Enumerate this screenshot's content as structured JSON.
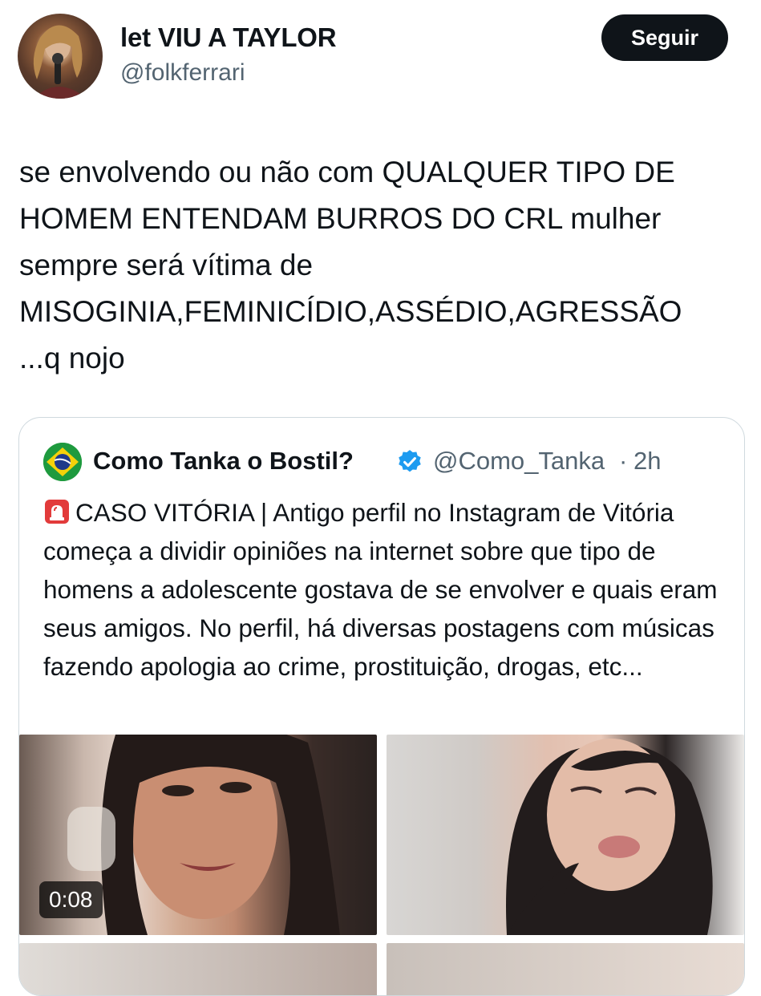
{
  "tweet": {
    "display_name": "let VIU A TAYLOR",
    "handle": "@folkferrari",
    "follow_label": "Seguir",
    "text": "se envolvendo ou não com QUALQUER TIPO DE\nHOMEM ENTENDAM BURROS DO CRL mulher\nsempre será vítima de\nMISOGINIA,FEMINICÍDIO,ASSÉDIO,AGRESSÃO\n...q nojo"
  },
  "quote": {
    "display_name": "Como Tanka o Bostil?",
    "handle": "@Como_Tanka",
    "separator": "·",
    "time": "2h",
    "text": "CASO VITÓRIA | Antigo perfil no Instagram de Vitória começa a dividir opiniões na internet sobre que tipo de homens a adolescente gostava de se envolver e quais eram seus amigos. No perfil, há diversas postagens com músicas fazendo apologia ao crime, prostituição, drogas, etc...",
    "video_duration": "0:08"
  },
  "colors": {
    "text": "#0f1419",
    "secondary": "#536471",
    "verified": "#1d9bf0",
    "border": "#cfd9de"
  },
  "icons": [
    "siren-icon",
    "verified-badge-icon",
    "brazil-flag-avatar"
  ]
}
